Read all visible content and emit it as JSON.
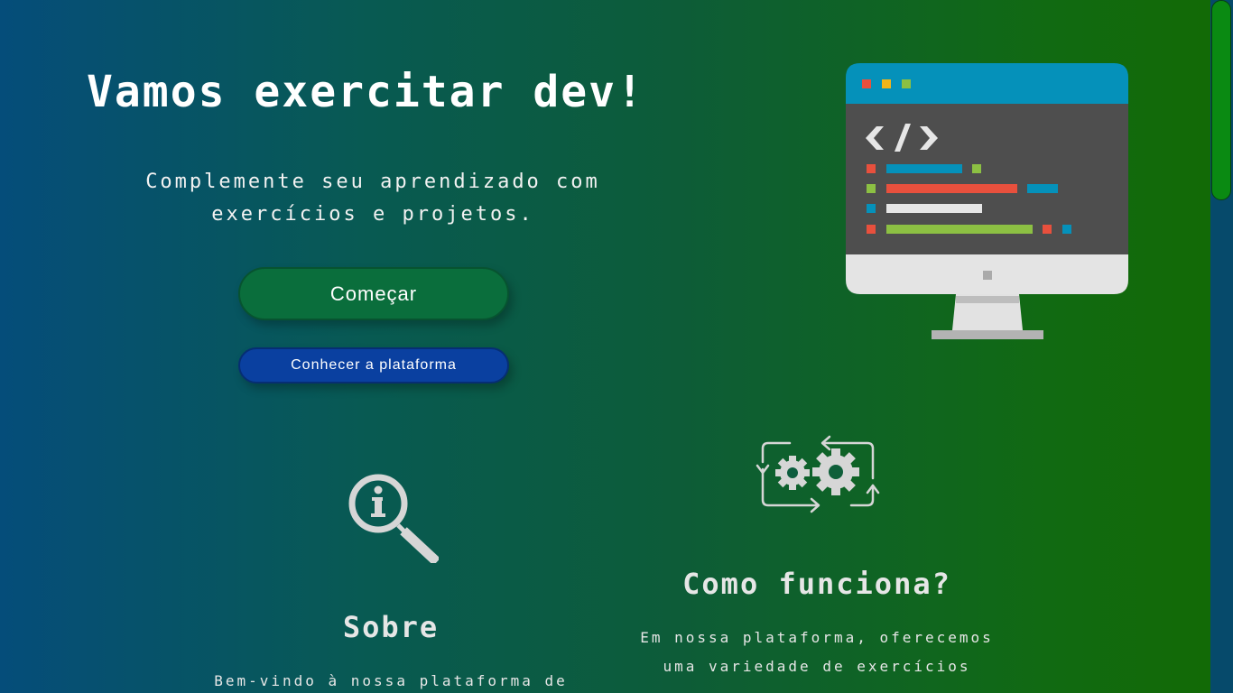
{
  "hero": {
    "title": "Vamos exercitar dev!",
    "subtitle": "Complemente seu aprendizado com exercícios e projetos.",
    "start_button": "Começar",
    "platform_button": "Conhecer a plataforma"
  },
  "illustration": {
    "name": "computer-code-icon",
    "code_tag": "</>"
  },
  "about": {
    "icon": "info-magnifier-icon",
    "title": "Sobre",
    "text": "Bem-vindo à nossa plataforma de"
  },
  "how": {
    "icon": "gears-cycle-icon",
    "title": "Como funciona?",
    "text": "Em nossa plataforma, oferecemos uma variedade de exercícios"
  },
  "colors": {
    "gradient_start": "#054d7a",
    "gradient_end": "#126a04",
    "start_button": "#0a6e3c",
    "platform_button": "#0a40a0",
    "scroll_thumb": "#0a8a12"
  }
}
